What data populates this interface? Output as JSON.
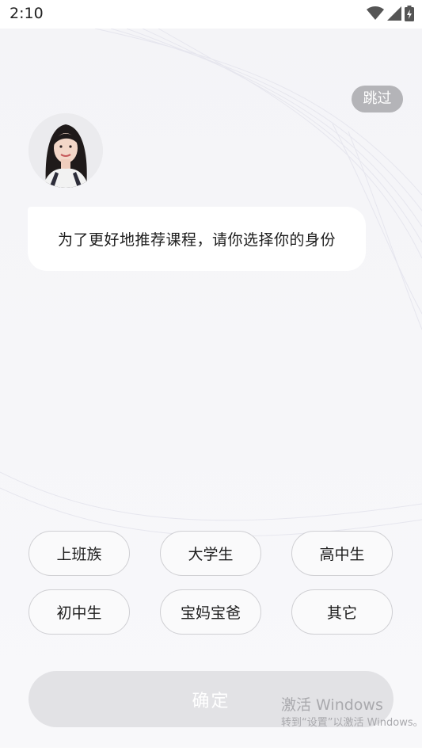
{
  "status_bar": {
    "time": "2:10",
    "icons": [
      "wifi-icon",
      "signal-icon",
      "battery-charging-icon"
    ]
  },
  "skip_label": "跳过",
  "avatar": {
    "icon": "avatar-photo"
  },
  "prompt": {
    "text": "为了更好地推荐课程，请你选择你的身份"
  },
  "options": [
    "上班族",
    "大学生",
    "高中生",
    "初中生",
    "宝妈宝爸",
    "其它"
  ],
  "confirm_label": "确定",
  "watermark": {
    "title": "激活 Windows",
    "subtitle": "转到“设置”以激活 Windows。"
  },
  "colors": {
    "skip_bg": "#b4b4b8",
    "confirm_bg_disabled": "#e2e2e5",
    "option_border": "#cfcfd3"
  }
}
